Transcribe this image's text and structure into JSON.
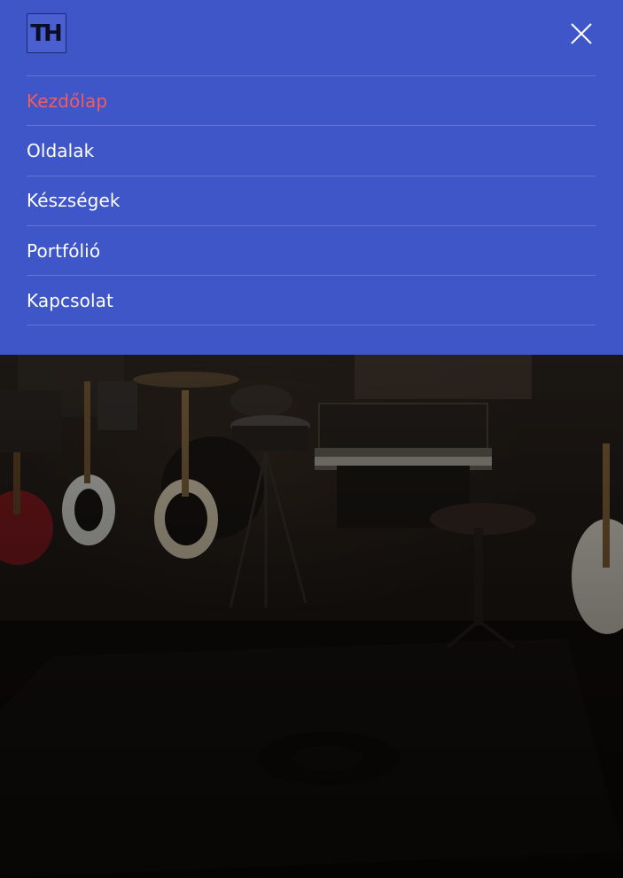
{
  "brand": {
    "logo_text": "TH"
  },
  "nav": {
    "items": [
      {
        "label": "Kezdőlap",
        "active": true
      },
      {
        "label": "Oldalak",
        "active": false
      },
      {
        "label": "Készségek",
        "active": false
      },
      {
        "label": "Portfólió",
        "active": false
      },
      {
        "label": "Kapcsolat",
        "active": false
      }
    ]
  },
  "colors": {
    "nav_background": "#3f56c9",
    "active_item": "#f25c5c",
    "item_text": "#ffffff"
  },
  "icons": {
    "close": "close-icon"
  }
}
